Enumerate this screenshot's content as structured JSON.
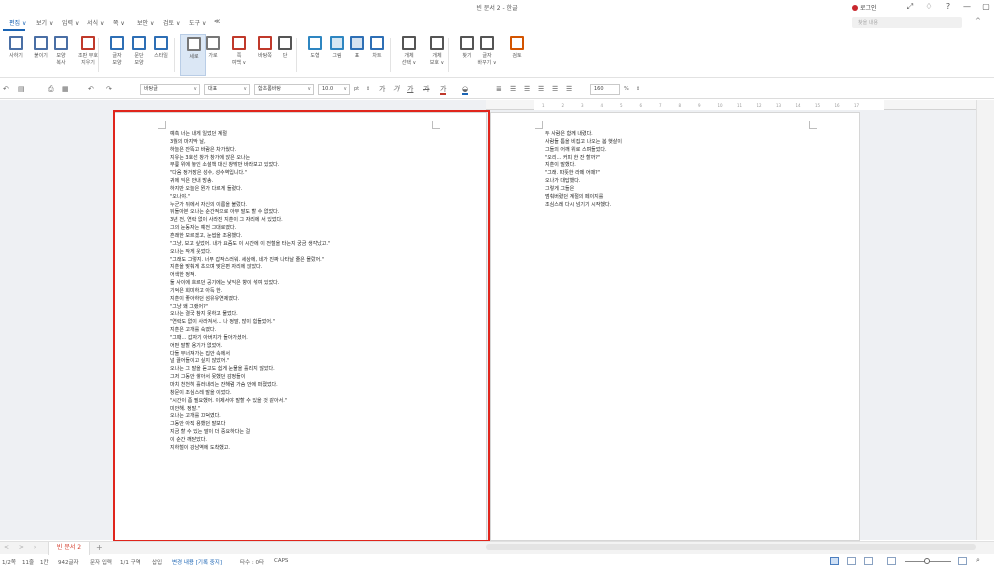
{
  "window": {
    "title": "빈 문서 2 - 한글",
    "login": "로그인",
    "controls": [
      "⤢",
      "♢",
      "?",
      "—",
      "▢"
    ]
  },
  "menu": {
    "items": [
      "편집 ∨",
      "보기 ∨",
      "입력 ∨",
      "서식 ∨",
      "쪽 ∨",
      "보안 ∨",
      "검토 ∨",
      "도구 ∨",
      "≪"
    ],
    "active_index": 0,
    "search_placeholder": "찾을 내용",
    "collapse": "^"
  },
  "ribbon": {
    "buttons": [
      {
        "label": "사하기",
        "icon": "copy-doc-icon",
        "color": "#4a6fa5"
      },
      {
        "label": "붙이기",
        "icon": "paste-icon",
        "color": "#4a6fa5"
      },
      {
        "label": "모양\n복사",
        "icon": "format-painter-icon",
        "color": "#4a6fa5"
      },
      {
        "label": "조판 부호\n지우기",
        "icon": "clear-format-icon",
        "color": "#c0392b"
      },
      {
        "label": "글자\n모양",
        "icon": "char-shape-icon",
        "color": "#2e6fb5"
      },
      {
        "label": "문단\n모양",
        "icon": "paragraph-shape-icon",
        "color": "#2e6fb5"
      },
      {
        "label": "스타일",
        "icon": "style-icon",
        "color": "#2e6fb5"
      },
      {
        "label": "세로",
        "icon": "vertical-layout-icon",
        "color": "#777777"
      },
      {
        "label": "가로",
        "icon": "horizontal-layout-icon",
        "color": "#777777"
      },
      {
        "label": "쪽\n여백 ∨",
        "icon": "page-margin-icon",
        "color": "#c0392b"
      },
      {
        "label": "바탕쪽",
        "icon": "master-page-icon",
        "color": "#c0392b"
      },
      {
        "label": "단",
        "icon": "columns-icon",
        "color": "#555555"
      },
      {
        "label": "도형",
        "icon": "shape-icon",
        "color": "#2e86c1"
      },
      {
        "label": "그림",
        "icon": "picture-icon",
        "color": "#2e86c1"
      },
      {
        "label": "표",
        "icon": "table-icon",
        "color": "#2e6fb5"
      },
      {
        "label": "차트",
        "icon": "chart-icon",
        "color": "#2e6fb5"
      },
      {
        "label": "개체\n선택 ∨",
        "icon": "object-select-icon",
        "color": "#555555"
      },
      {
        "label": "개체\n보호 ∨",
        "icon": "object-protect-icon",
        "color": "#555555"
      },
      {
        "label": "찾기",
        "icon": "find-icon",
        "color": "#555555"
      },
      {
        "label": "글자\n바꾸기 ∨",
        "icon": "replace-icon",
        "color": "#555555"
      },
      {
        "label": "검토",
        "icon": "review-icon",
        "color": "#d35400"
      }
    ]
  },
  "format_toolbar": {
    "style": "바탕글",
    "lang": "대표",
    "font": "함초롬바탕",
    "size": "10.0",
    "size_unit": "pt",
    "zoom": "160",
    "zoom_unit": "%",
    "bold": "가",
    "italic": "가",
    "underline": "가",
    "strike": "가",
    "font_color": "가",
    "text_color_hex": "#c0392b",
    "highlight_color_hex": "#1a64b4"
  },
  "ruler": [
    "1",
    "2",
    "3",
    "4",
    "5",
    "6",
    "7",
    "8",
    "9",
    "10",
    "11",
    "12",
    "13",
    "14",
    "15",
    "16",
    "17"
  ],
  "document": {
    "page1_lines": [
      "예측 너는 내게 일었던 계절",
      "3월의 마지막 날,",
      "하늘은 잔뜩고 바람은 차가웠다.",
      "지유는 3호선 창가 창가에 앉은 오나는",
      "무릎 위에 놓인 소설책 대신 창밖만 바라보고 있었다.",
      "\"다음 정거장은 성수, 성수역입니다.\"",
      "귀에 익은 안내 방송.",
      "하지만 오늘은 뭔가 다르게 들렸다.",
      "\"오나야.\"",
      "누군가 뒤에서 자신의 이름을 불렀다.",
      "뒤돌아본 오나는 순간적으로 아무 말도 할 수 없었다.",
      "3년 전, 연락 없이 사라진 지훈이 그 자리에 서 있었다.",
      "그의 눈동자는 예전 그대로였다.",
      "흔쾌한 모르겠고, 눈썹을 조용했다.",
      "\"그냥, 보고 싶었어. 내가 요즘도 이 시간에 이 전철을 타는지 궁금 생각났고.\"",
      "오나는 작게 웃었다.",
      "\"그래도 그렇지. 너무 갑작스러워. 세상에, 네가 진짜 나타날 줄은 몰랐어.\"",
      "지훈을 맞춰게 초으며 맞은편 자리에 앉았다.",
      "어색한 정적.",
      "둘 사이에 흐르던 공기에는 낯익은 향이 섞여 있었다.",
      "기억은 희미하고 아득 한.",
      "지훈이 좋아하던 섬유유연제였다.",
      "\"그냥 왜 그랬어?\"",
      "오나는 결국 참지 못하고 물었다.",
      "\"연락도 없이 사라져서... 나 정말, 많이 힘들었어.\"",
      "지훈은 고개를 숙였다.",
      "\"그때... 갑자기 아버지가 돌아가셨어.",
      "어떤 말할 용기가 없었어.",
      "다들 무너져가는 집안 속에서",
      "널 끌어들이고 싶지 않았어.\"",
      "오나는 그 말을 듣고도 쉽게 눈물을 흘리지 않았다.",
      "그저 그동안 쌓아서 못했던 감정들이",
      "마치 천천히 흘러내리는 잔해럼 가슴 안에 퍼졌었다.",
      "창문이 조심스레 말을 이었다.",
      "\"시간이 좀 필요했어. 이제서야 말할 수 있을 것 같아서.\"",
      "미안해. 정말.\"",
      "오나는 고개를 끄덕였다.",
      "그동안 아직 용했던 말보다",
      "지금 할 수 있는 말이 더 중요하다는 걸",
      "이 순간 깨닫았다.",
      "지하철이 강남역에 도착했고."
    ],
    "page2_lines": [
      "두 사람은 함께 내렸다.",
      "사람들 틈을 비집고 나오는 봄 햇살이",
      "그들의 어깨 위로 스며들었다.",
      "\"오리... 커피 한 잔 할까?\"",
      "지훈이 말했다.",
      "\"그래. 따뜻한 라떼 어때?\"",
      "오나가 대답했다.",
      "그렇게 그들은",
      "멈춰버렸던 계절의 페이지를",
      "조심스레 다시 넘기기 시작했다."
    ]
  },
  "tabs": {
    "nav": "< > ›",
    "current": "빈 문서 2",
    "add": "+"
  },
  "status": {
    "page": "1/2쪽",
    "line": "11줄",
    "col": "1칸",
    "chars": "942글자",
    "mode": "문자 입력",
    "section": "1/1 구역",
    "insert": "삽입",
    "track": "변경 내용 [기록 중지]",
    "hits": "타수 : 0타",
    "caps": "CAPS"
  },
  "colors": {
    "accent": "#1a64b4",
    "frame": "#e0251c",
    "tab_text": "#d23a2a"
  }
}
